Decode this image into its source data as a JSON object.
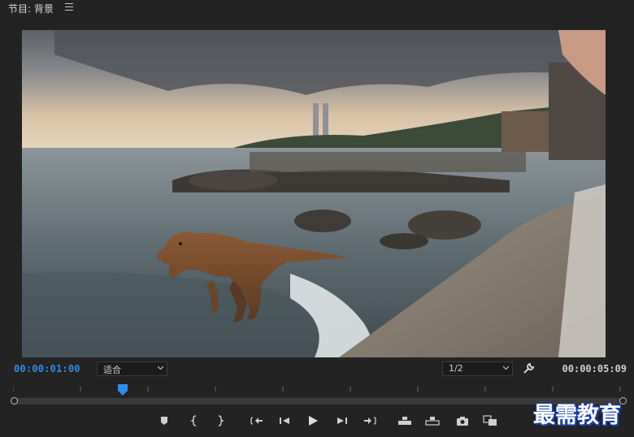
{
  "panel": {
    "title": "节目: 背景"
  },
  "timecode": {
    "current": "00:00:01:00",
    "duration": "00:00:05:09"
  },
  "zoom": {
    "selected": "适合"
  },
  "resolution": {
    "selected": "1/2"
  },
  "playhead": {
    "position_fraction": 0.18
  },
  "colors": {
    "timecode_accent": "#2d8ceb",
    "background": "#232323",
    "watermark": "#1a3fb3"
  },
  "watermark": {
    "text": "最需教育"
  }
}
